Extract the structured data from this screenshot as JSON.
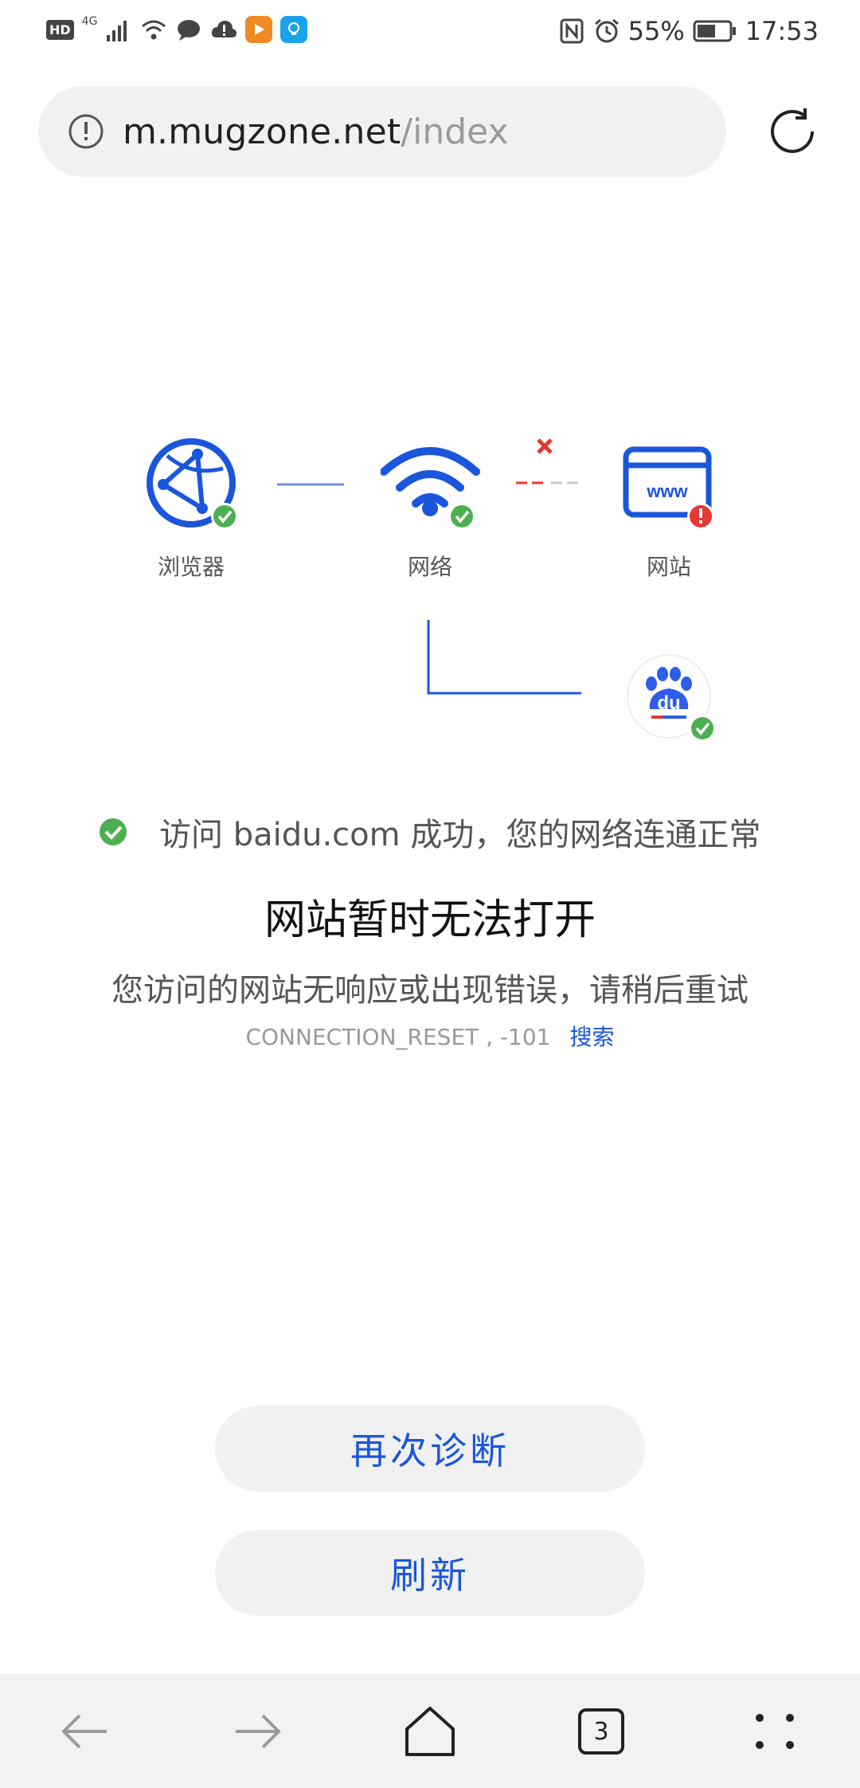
{
  "status_bar": {
    "left_badge": "HD",
    "network": "4G",
    "battery": "55%",
    "time": "17:53"
  },
  "address_bar": {
    "host": "m.mugzone.net",
    "path": "/index"
  },
  "diagram": {
    "browser_label": "浏览器",
    "network_label": "网络",
    "website_label": "网站",
    "www_text": "www",
    "baidu_text": "du"
  },
  "diagnosis": {
    "success_text": "访问 baidu.com 成功，您的网络连通正常",
    "title": "网站暂时无法打开",
    "subtitle": "您访问的网站无响应或出现错误，请稍后重试",
    "error_code": "CONNECTION_RESET , -101",
    "search_link": "搜索"
  },
  "buttons": {
    "rediagnose": "再次诊断",
    "refresh": "刷新"
  },
  "bottom_nav": {
    "tab_count": "3"
  },
  "colors": {
    "accent_blue": "#1a56db",
    "success_green": "#4caf50",
    "error_red": "#e53935"
  }
}
